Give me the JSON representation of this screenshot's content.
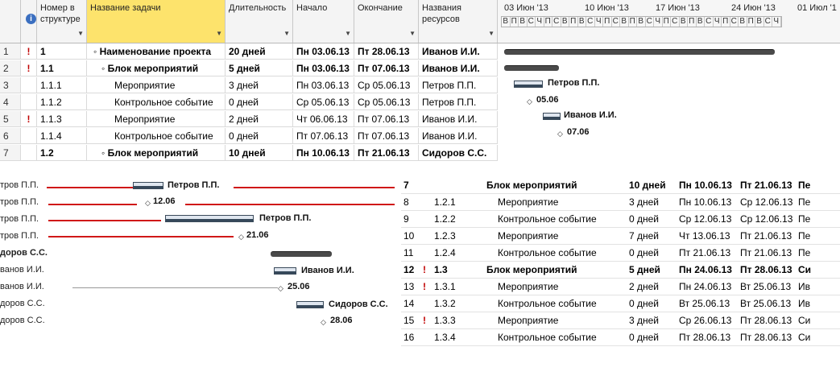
{
  "columns": {
    "outline": "Номер в структуре",
    "task_name": "Название задачи",
    "duration": "Длительность",
    "start": "Начало",
    "finish": "Окончание",
    "resources": "Названия ресурсов"
  },
  "gantt_header": {
    "weeks": [
      "03 Июн '13",
      "10 Июн '13",
      "17 Июн '13",
      "24 Июн '13",
      "01 Июл '1"
    ],
    "days": [
      "В",
      "П",
      "В",
      "С",
      "Ч",
      "П",
      "С",
      "В",
      "П",
      "В",
      "С",
      "Ч",
      "П",
      "С",
      "В",
      "П",
      "В",
      "С",
      "Ч",
      "П",
      "С",
      "В",
      "П",
      "В",
      "С",
      "Ч",
      "П",
      "С",
      "В",
      "П",
      "В",
      "С",
      "Ч"
    ]
  },
  "top_rows": [
    {
      "n": "1",
      "ind": "!",
      "outline": "1",
      "name": "Наименование проекта",
      "dur": "20 дней",
      "start": "Пн 03.06.13",
      "finish": "Пт 28.06.13",
      "res": "Иванов И.И.",
      "bold": true
    },
    {
      "n": "2",
      "ind": "!",
      "outline": "1.1",
      "name": "Блок мероприятий",
      "dur": "5 дней",
      "start": "Пн 03.06.13",
      "finish": "Пт 07.06.13",
      "res": "Иванов И.И.",
      "bold": true
    },
    {
      "n": "3",
      "ind": "",
      "outline": "1.1.1",
      "name": "Мероприятие",
      "dur": "3 дней",
      "start": "Пн 03.06.13",
      "finish": "Ср 05.06.13",
      "res": "Петров П.П.",
      "bold": false
    },
    {
      "n": "4",
      "ind": "",
      "outline": "1.1.2",
      "name": "Контрольное событие",
      "dur": "0 дней",
      "start": "Ср 05.06.13",
      "finish": "Ср 05.06.13",
      "res": "Петров П.П.",
      "bold": false
    },
    {
      "n": "5",
      "ind": "!",
      "outline": "1.1.3",
      "name": "Мероприятие",
      "dur": "2 дней",
      "start": "Чт 06.06.13",
      "finish": "Пт 07.06.13",
      "res": "Иванов И.И.",
      "bold": false
    },
    {
      "n": "6",
      "ind": "",
      "outline": "1.1.4",
      "name": "Контрольное событие",
      "dur": "0 дней",
      "start": "Пт 07.06.13",
      "finish": "Пт 07.06.13",
      "res": "Иванов И.И.",
      "bold": false
    },
    {
      "n": "7",
      "ind": "",
      "outline": "1.2",
      "name": "Блок мероприятий",
      "dur": "10 дней",
      "start": "Пн 10.06.13",
      "finish": "Пт 21.06.13",
      "res": "Сидоров С.С.",
      "bold": true
    }
  ],
  "gantt_labels": {
    "r3": "Петров П.П.",
    "r4": "05.06",
    "r5": "Иванов И.И.",
    "r6": "07.06"
  },
  "bottom_left": {
    "resources": [
      "тров П.П.",
      "тров П.П.",
      "тров П.П.",
      "тров П.П.",
      "доров С.С.",
      "ванов И.И.",
      "ванов И.И.",
      "доров С.С.",
      "доров С.С."
    ],
    "labels": {
      "a": "Петров П.П.",
      "b": "12.06",
      "c": "Петров П.П.",
      "d": "21.06",
      "e": "Иванов И.И.",
      "f": "25.06",
      "g": "Сидоров С.С.",
      "h": "28.06"
    }
  },
  "bottom_right_rows": [
    {
      "n": "7",
      "ind": "",
      "outline": "",
      "name": "Блок мероприятий",
      "dur": "10 дней",
      "start": "Пн 10.06.13",
      "finish": "Пт 21.06.13",
      "res": "Пе",
      "bold": true
    },
    {
      "n": "8",
      "ind": "",
      "outline": "1.2.1",
      "name": "Мероприятие",
      "dur": "3 дней",
      "start": "Пн 10.06.13",
      "finish": "Ср 12.06.13",
      "res": "Пе",
      "bold": false
    },
    {
      "n": "9",
      "ind": "",
      "outline": "1.2.2",
      "name": "Контрольное событие",
      "dur": "0 дней",
      "start": "Ср 12.06.13",
      "finish": "Ср 12.06.13",
      "res": "Пе",
      "bold": false
    },
    {
      "n": "10",
      "ind": "",
      "outline": "1.2.3",
      "name": "Мероприятие",
      "dur": "7 дней",
      "start": "Чт 13.06.13",
      "finish": "Пт 21.06.13",
      "res": "Пе",
      "bold": false
    },
    {
      "n": "11",
      "ind": "",
      "outline": "1.2.4",
      "name": "Контрольное событие",
      "dur": "0 дней",
      "start": "Пт 21.06.13",
      "finish": "Пт 21.06.13",
      "res": "Пе",
      "bold": false
    },
    {
      "n": "12",
      "ind": "!",
      "outline": "1.3",
      "name": "Блок мероприятий",
      "dur": "5 дней",
      "start": "Пн 24.06.13",
      "finish": "Пт 28.06.13",
      "res": "Си",
      "bold": true
    },
    {
      "n": "13",
      "ind": "!",
      "outline": "1.3.1",
      "name": "Мероприятие",
      "dur": "2 дней",
      "start": "Пн 24.06.13",
      "finish": "Вт 25.06.13",
      "res": "Ив",
      "bold": false
    },
    {
      "n": "14",
      "ind": "",
      "outline": "1.3.2",
      "name": "Контрольное событие",
      "dur": "0 дней",
      "start": "Вт 25.06.13",
      "finish": "Вт 25.06.13",
      "res": "Ив",
      "bold": false
    },
    {
      "n": "15",
      "ind": "!",
      "outline": "1.3.3",
      "name": "Мероприятие",
      "dur": "3 дней",
      "start": "Ср 26.06.13",
      "finish": "Пт 28.06.13",
      "res": "Си",
      "bold": false
    },
    {
      "n": "16",
      "ind": "",
      "outline": "1.3.4",
      "name": "Контрольное событие",
      "dur": "0 дней",
      "start": "Пт 28.06.13",
      "finish": "Пт 28.06.13",
      "res": "Си",
      "bold": false
    }
  ],
  "colors": {
    "selected_header": "#fde36c",
    "indicator": "#c00000",
    "info_icon": "#3b6fc0"
  },
  "icons": {
    "indicator": "task-indicator-icon",
    "info": "info-icon"
  }
}
